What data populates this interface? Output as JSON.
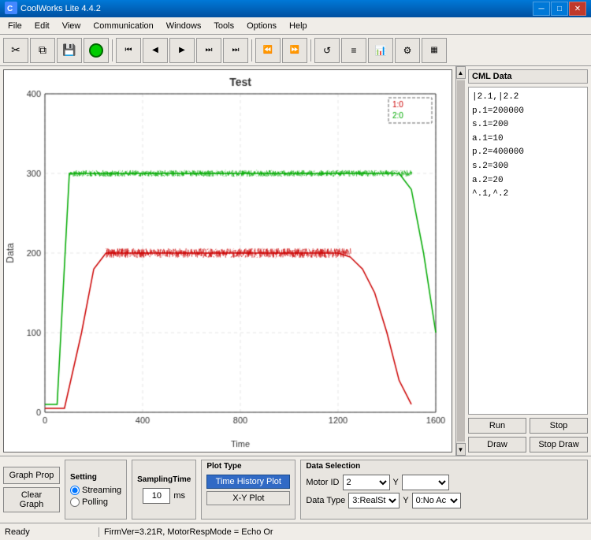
{
  "titlebar": {
    "title": "CoolWorks Lite 4.4.2",
    "min_label": "─",
    "max_label": "□",
    "close_label": "✕"
  },
  "menu": {
    "items": [
      "File",
      "Edit",
      "View",
      "Communication",
      "Windows",
      "Tools",
      "Options",
      "Help"
    ]
  },
  "toolbar": {
    "buttons": [
      "✂",
      "📋",
      "💾",
      "●",
      "◀◀",
      "◀",
      "▶",
      "⏭",
      "⏭⏭",
      "⏪",
      "⏩",
      "↺",
      "≡",
      "📊",
      "⚙"
    ]
  },
  "cml": {
    "panel_title": "CML Data",
    "data_lines": [
      "|2.1,|2.2",
      "p.1=200000",
      "s.1=200",
      "a.1=10",
      "p.2=400000",
      "s.2=300",
      "a.2=20",
      "^.1,^.2"
    ],
    "run_label": "Run",
    "stop_label": "Stop",
    "draw_label": "Draw",
    "stop_draw_label": "Stop Draw"
  },
  "graph": {
    "title": "Test",
    "x_axis_label": "Time",
    "y_axis_label": "Data",
    "legend": {
      "line1": "1:0",
      "line2": "2:0"
    },
    "x_ticks": [
      "0",
      "400",
      "800",
      "1200",
      "1600"
    ],
    "y_ticks": [
      "0",
      "100",
      "200",
      "300",
      "400"
    ]
  },
  "bottom": {
    "setting_label": "Setting",
    "streaming_label": "Streaming",
    "polling_label": "Polling",
    "sampling_label": "SamplingTime",
    "sampling_value": "10",
    "sampling_unit": "ms",
    "plot_type_label": "Plot Type",
    "history_plot_label": "Time History Plot",
    "xy_plot_label": "X-Y Plot",
    "data_sel_label": "Data Selection",
    "motor_id_label": "Motor ID",
    "motor_id_value": "2",
    "y_label": "Y",
    "data_type_label": "Data Type",
    "data_type_value": "3:RealSt ▼",
    "y2_label": "Y",
    "data_type2_value": "0:No Ac ▼",
    "graph_prop_label": "Graph Prop",
    "clear_graph_label": "Clear Graph"
  },
  "statusbar": {
    "left": "Ready",
    "right": "FirmVer=3.21R, MotorRespMode = Echo Or"
  }
}
